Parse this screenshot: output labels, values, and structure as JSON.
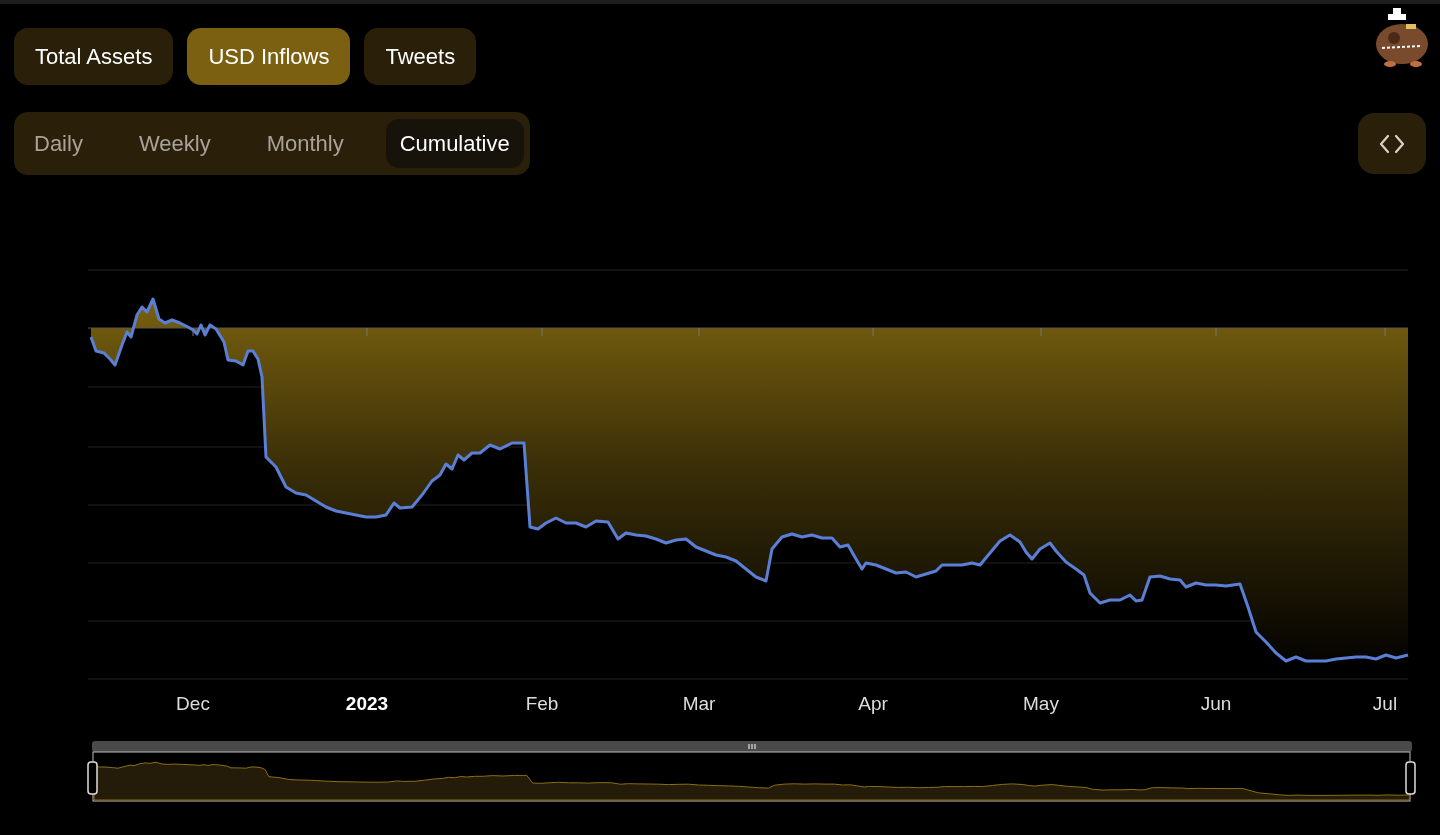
{
  "chart_tabs": [
    {
      "label": "Total Assets",
      "selected": false
    },
    {
      "label": "USD Inflows",
      "selected": true
    },
    {
      "label": "Tweets",
      "selected": false
    }
  ],
  "period_tabs": [
    {
      "label": "Daily",
      "selected": false
    },
    {
      "label": "Weekly",
      "selected": false
    },
    {
      "label": "Monthly",
      "selected": false
    },
    {
      "label": "Cumulative",
      "selected": true
    }
  ],
  "chart": {
    "x_axis_labels": [
      {
        "text": "Dec",
        "emphasized": false
      },
      {
        "text": "2023",
        "emphasized": true
      },
      {
        "text": "Feb",
        "emphasized": false
      },
      {
        "text": "Mar",
        "emphasized": false
      },
      {
        "text": "Apr",
        "emphasized": false
      },
      {
        "text": "May",
        "emphasized": false
      },
      {
        "text": "Jun",
        "emphasized": false
      },
      {
        "text": "Jul",
        "emphasized": false
      }
    ]
  }
}
